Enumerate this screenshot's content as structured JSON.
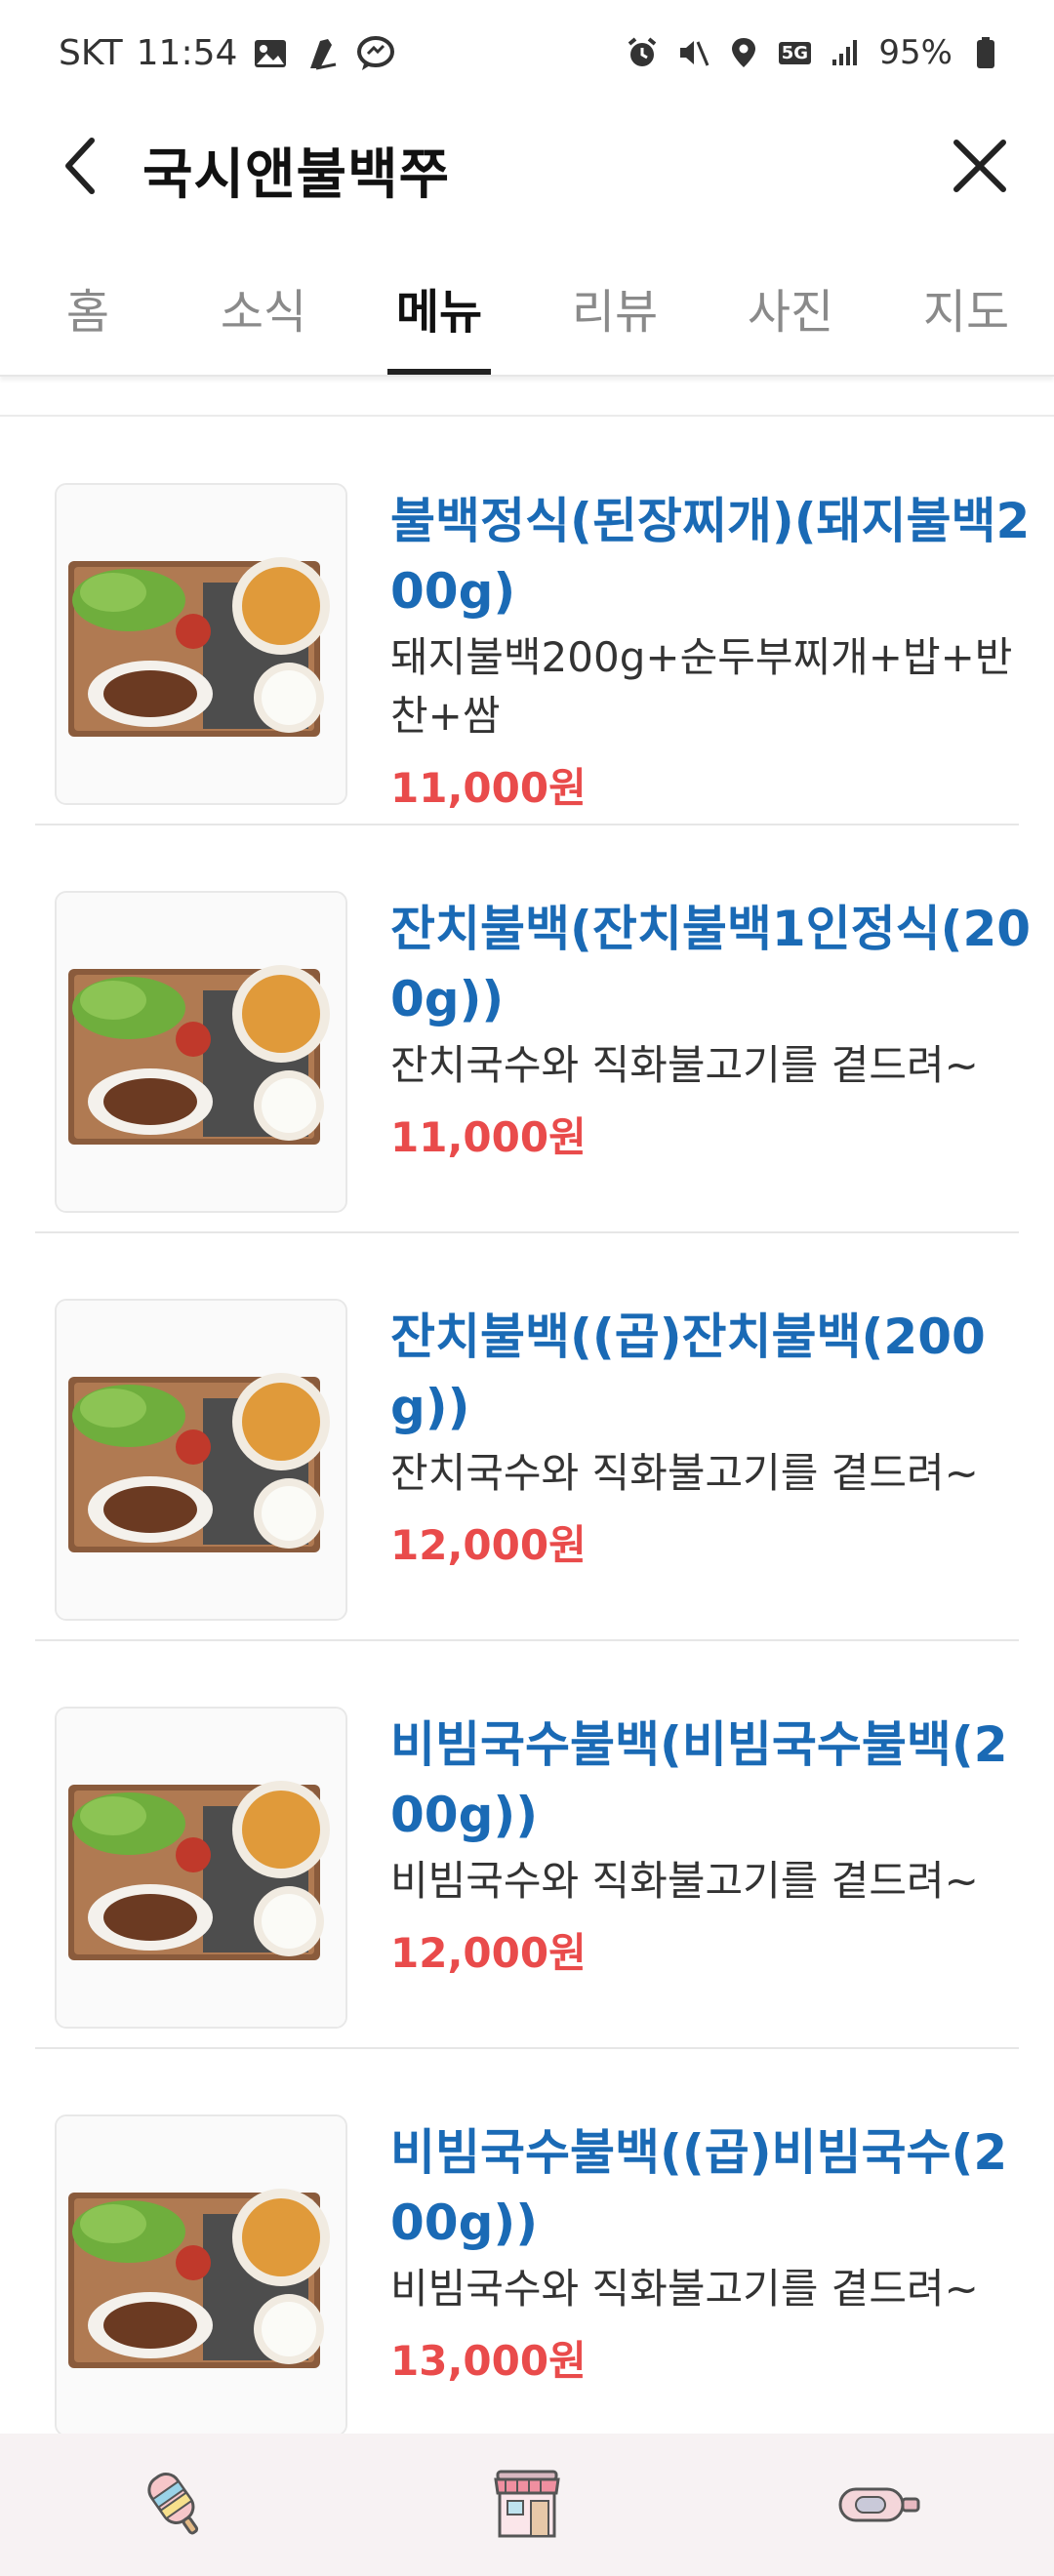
{
  "status_bar": {
    "carrier": "SKT",
    "time": "11:54",
    "network": "5G",
    "battery": "95%"
  },
  "header": {
    "title": "국시앤불백쭈"
  },
  "tabs": [
    {
      "label": "홈"
    },
    {
      "label": "소식"
    },
    {
      "label": "메뉴"
    },
    {
      "label": "리뷰"
    },
    {
      "label": "사진"
    },
    {
      "label": "지도"
    }
  ],
  "active_tab": "메뉴",
  "menu_items": [
    {
      "name": "불백정식(된장찌개)(돼지불백200g)",
      "desc": "돼지불백200g+순두부찌개+밥+반찬+쌈",
      "price": "11,000원"
    },
    {
      "name": "잔치불백(잔치불백1인정식(200g))",
      "desc": "잔치국수와 직화불고기를 곁드려~",
      "price": "11,000원"
    },
    {
      "name": "잔치불백((곱)잔치불백(200g))",
      "desc": "잔치국수와 직화불고기를 곁드려~",
      "price": "12,000원"
    },
    {
      "name": "비빔국수불백(비빔국수불백(200g))",
      "desc": "비빔국수와 직화불고기를 곁드려~",
      "price": "12,000원"
    },
    {
      "name": "비빔국수불백((곱)비빔국수(200g))",
      "desc": "비빔국수와 직화불고기를 곁드려~",
      "price": "13,000원"
    }
  ],
  "colors": {
    "item_name": "#1a6ab5",
    "price": "#e94b4b",
    "bottom_nav_bg": "#f7f2f3"
  }
}
